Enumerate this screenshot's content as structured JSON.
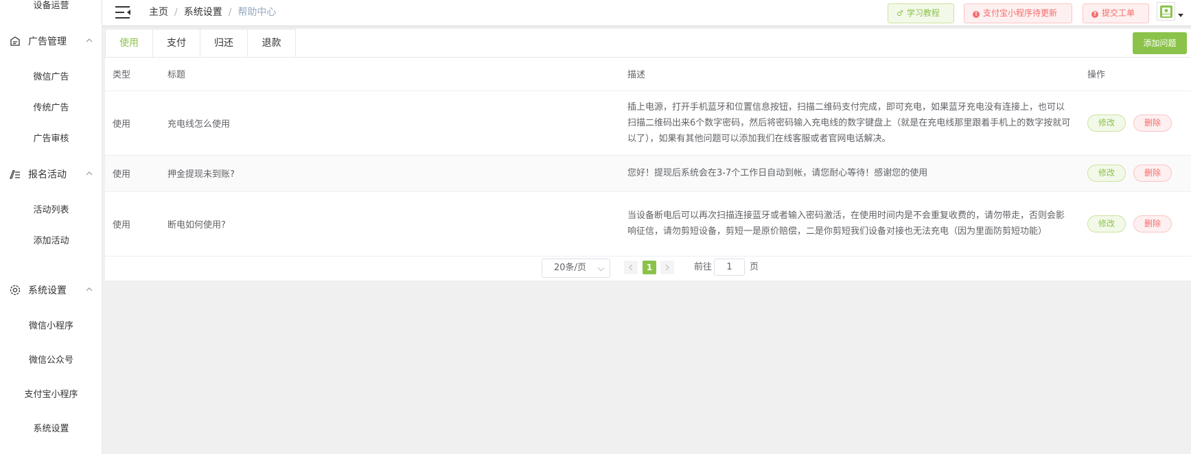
{
  "sidebar": {
    "top_item": "设备运营",
    "groups": [
      {
        "label": "广告管理",
        "icon": "ad-icon",
        "items": [
          "微信广告",
          "传统广告",
          "广告审核"
        ]
      },
      {
        "label": "报名活动",
        "icon": "signup-icon",
        "items": [
          "活动列表",
          "添加活动"
        ]
      },
      {
        "label": "系统设置",
        "icon": "gear-icon",
        "items": [
          "微信小程序",
          "微信公众号",
          "支付宝小程序",
          "系统设置"
        ]
      }
    ]
  },
  "header": {
    "breadcrumb": [
      "主页",
      "系统设置",
      "帮助中心"
    ],
    "separator": "/",
    "learn_label": "学习教程",
    "alipay_label": "支付宝小程序待更新",
    "ticket_label": "提交工单"
  },
  "tabs": [
    "使用",
    "支付",
    "归还",
    "退款"
  ],
  "active_tab": "使用",
  "add_button": "添加问题",
  "table": {
    "columns": [
      "类型",
      "标题",
      "描述",
      "操作"
    ],
    "rows": [
      {
        "type": "使用",
        "title": "充电线怎么使用",
        "desc": "插上电源，打开手机蓝牙和位置信息按钮，扫描二维码支付完成，即可充电，如果蓝牙充电没有连接上，也可以扫描二维码出来6个数字密码，然后将密码输入充电线的数字键盘上（就是在充电线那里跟着手机上的数字按就可以了），如果有其他问题可以添加我们在线客服或者官网电话解决。"
      },
      {
        "type": "使用",
        "title": "押金提现未到账?",
        "desc": "您好！提现后系统会在3-7个工作日自动到帐，请您耐心等待！感谢您的使用"
      },
      {
        "type": "使用",
        "title": "断电如何使用?",
        "desc": "当设备断电后可以再次扫描连接蓝牙或者输入密码激活，在使用时间内是不会重复收费的，请勿带走，否则会影响征信，请勿剪短设备，剪短一是原价赔偿，二是你剪短我们设备对接也无法充电（因为里面防剪短功能）"
      }
    ],
    "edit_label": "修改",
    "delete_label": "删除"
  },
  "pagination": {
    "page_size": "20条/页",
    "current_page": "1",
    "goto_label": "前往",
    "goto_value": "1",
    "page_suffix": "页"
  },
  "colors": {
    "accent": "#8bc34a",
    "danger": "#f56c6c",
    "background": "#f0f0f0"
  }
}
